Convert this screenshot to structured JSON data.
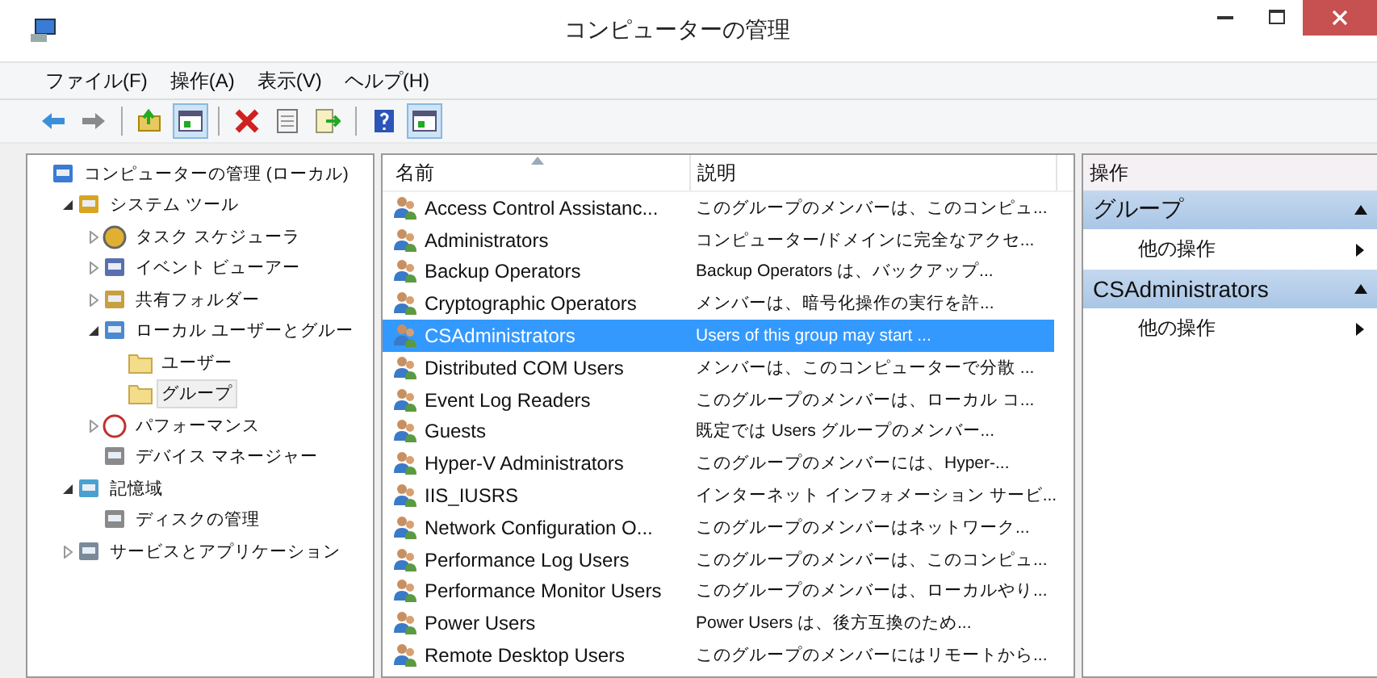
{
  "window": {
    "title": "コンピューターの管理"
  },
  "menu": [
    "ファイル(F)",
    "操作(A)",
    "表示(V)",
    "ヘルプ(H)"
  ],
  "toolbar": [
    [
      {
        "kind": "back",
        "active": false
      },
      {
        "kind": "forward",
        "active": false
      }
    ],
    [
      {
        "kind": "up",
        "active": false
      },
      {
        "kind": "tree",
        "active": true
      }
    ],
    [
      {
        "kind": "delete",
        "active": false
      },
      {
        "kind": "properties",
        "active": false
      },
      {
        "kind": "export",
        "active": false
      }
    ],
    [
      {
        "kind": "help",
        "active": false
      },
      {
        "kind": "actionpane",
        "active": true
      }
    ]
  ],
  "tree": [
    {
      "label": "コンピューターの管理 (ローカル)",
      "kind": "computer",
      "selected": false,
      "children": [
        {
          "label": "システム ツール",
          "kind": "tools",
          "expanded": true,
          "selected": false,
          "children": [
            {
              "label": "タスク スケジューラ",
              "kind": "clock",
              "expanded": false,
              "selected": false
            },
            {
              "label": "イベント ビューアー",
              "kind": "log",
              "expanded": false,
              "selected": false
            },
            {
              "label": "共有フォルダー",
              "kind": "share",
              "expanded": false,
              "selected": false
            },
            {
              "label": "ローカル ユーザーとグルー",
              "kind": "users",
              "expanded": true,
              "selected": false,
              "children": [
                {
                  "label": "ユーザー",
                  "kind": "folder",
                  "selected": false
                },
                {
                  "label": "グループ",
                  "kind": "folder",
                  "selected": true
                }
              ]
            },
            {
              "label": "パフォーマンス",
              "kind": "perf",
              "expanded": false,
              "selected": false
            },
            {
              "label": "デバイス マネージャー",
              "kind": "device",
              "selected": false
            }
          ]
        },
        {
          "label": "記憶域",
          "kind": "storage",
          "expanded": true,
          "selected": false,
          "children": [
            {
              "label": "ディスクの管理",
              "kind": "device",
              "selected": false
            }
          ]
        },
        {
          "label": "サービスとアプリケーション",
          "kind": "services",
          "expanded": false,
          "selected": false
        }
      ]
    }
  ],
  "table": {
    "columns": [
      "名前",
      "説明"
    ],
    "rows": [
      {
        "name": "Access Control Assistanc...",
        "description": "このグループのメンバーは、このコンピュ...",
        "selected": false
      },
      {
        "name": "Administrators",
        "description": "コンピューター/ドメインに完全なアクセ...",
        "selected": false
      },
      {
        "name": "Backup Operators",
        "description": "Backup Operators は、バックアップ...",
        "selected": false
      },
      {
        "name": "Cryptographic Operators",
        "description": "メンバーは、暗号化操作の実行を許...",
        "selected": false
      },
      {
        "name": "CSAdministrators",
        "description": "Users of this group may start ...",
        "selected": true
      },
      {
        "name": "Distributed COM Users",
        "description": "メンバーは、このコンピューターで分散 ...",
        "selected": false
      },
      {
        "name": "Event Log Readers",
        "description": "このグループのメンバーは、ローカル コ...",
        "selected": false
      },
      {
        "name": "Guests",
        "description": "既定では Users グループのメンバー...",
        "selected": false
      },
      {
        "name": "Hyper-V Administrators",
        "description": "このグループのメンバーには、Hyper-...",
        "selected": false
      },
      {
        "name": "IIS_IUSRS",
        "description": "インターネット インフォメーション サービ...",
        "selected": false
      },
      {
        "name": "Network Configuration O...",
        "description": "このグループのメンバーはネットワーク...",
        "selected": false
      },
      {
        "name": "Performance Log Users",
        "description": "このグループのメンバーは、このコンピュ...",
        "selected": false
      },
      {
        "name": "Performance Monitor Users",
        "description": "このグループのメンバーは、ローカルやり...",
        "selected": false
      },
      {
        "name": "Power Users",
        "description": "Power Users は、後方互換のため...",
        "selected": false
      },
      {
        "name": "Remote Desktop Users",
        "description": "このグループのメンバーにはリモートから...",
        "selected": false
      }
    ]
  },
  "actions": {
    "title": "操作",
    "sections": [
      {
        "header": "グループ",
        "items": [
          "他の操作"
        ]
      },
      {
        "header": "CSAdministrators",
        "items": [
          "他の操作"
        ]
      }
    ]
  }
}
